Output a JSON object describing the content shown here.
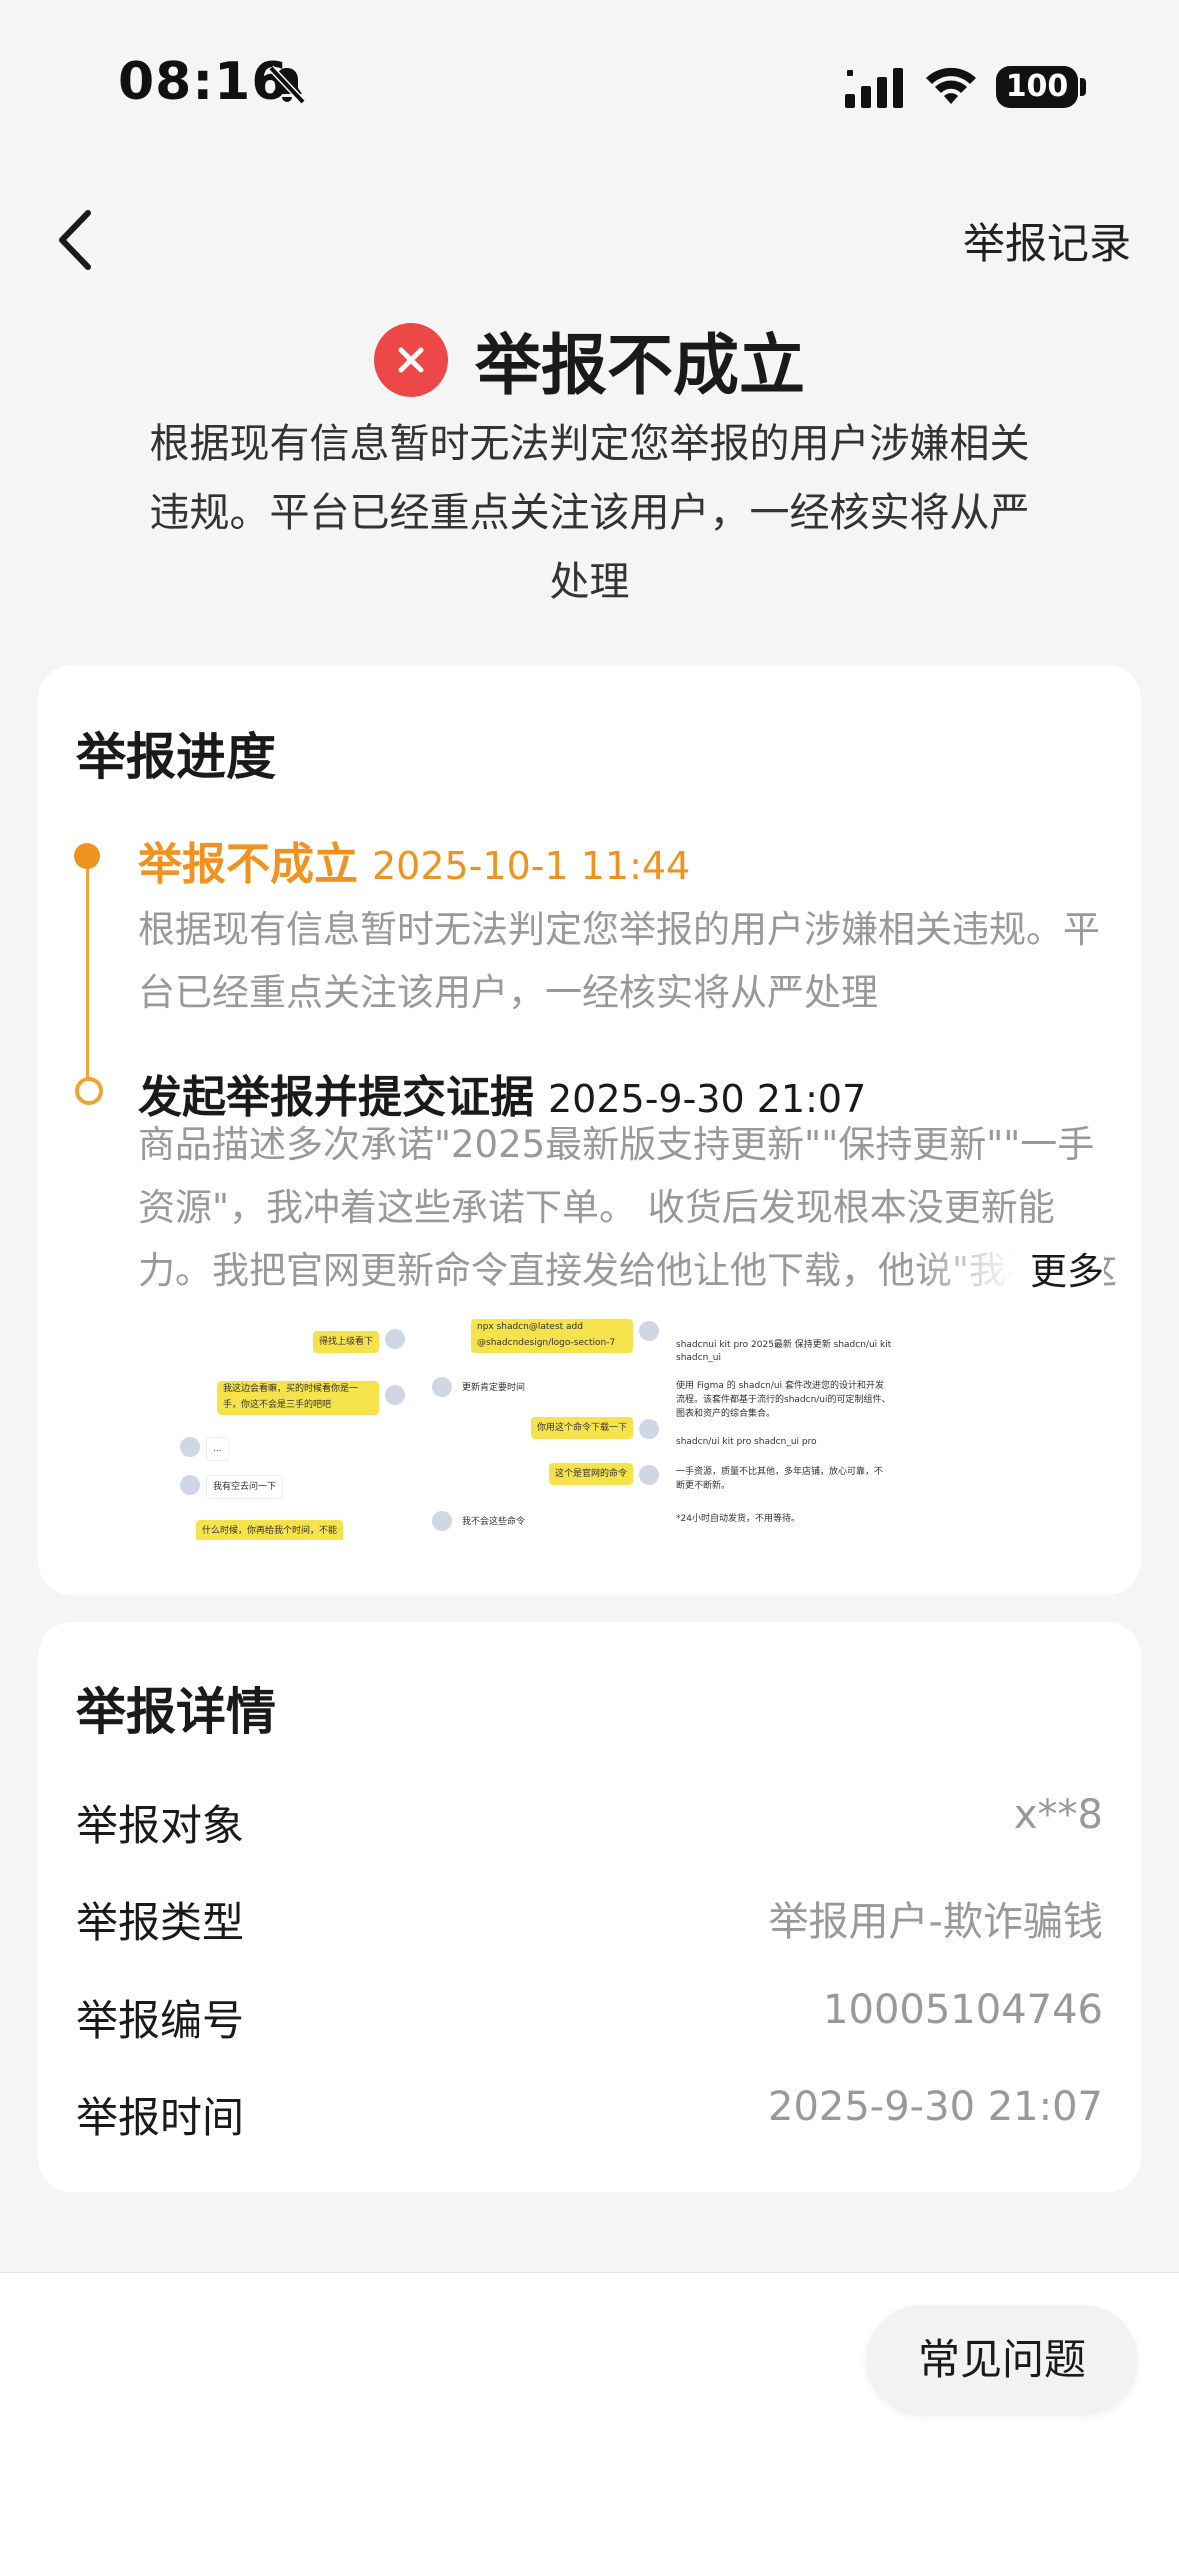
{
  "status_bar": {
    "time": "08:16",
    "battery": "100"
  },
  "nav": {
    "history_label": "举报记录"
  },
  "result": {
    "title": "举报不成立",
    "description": "根据现有信息暂时无法判定您举报的用户涉嫌相关违规。平台已经重点关注该用户，一经核实将从严处理"
  },
  "progress": {
    "section_title": "举报进度",
    "steps": [
      {
        "title": "举报不成立",
        "time": "2025-10-1 11:44",
        "description": "根据现有信息暂时无法判定您举报的用户涉嫌相关违规。平台已经重点关注该用户，一经核实将从严处理"
      },
      {
        "title": "发起举报并提交证据",
        "time": "2025-9-30 21:07",
        "description": "商品描述多次承诺\"2025最新版支持更新\"\"保持更新\"\"一手资源\"，我冲着这些承诺下单。 收货后发现根本没更新能力。我把官网更新命令直接发给他让他下载，他说\"我不会这",
        "more_label": "更多"
      }
    ],
    "evidence": {
      "chat1": [
        "得找上级看下",
        "我这边会看嘛，买的时候看你是一手，你这不会是三手的吧吧",
        "...",
        "我有空去问一下",
        "什么时候，你再给我个时间，不能"
      ],
      "chat2": [
        "npx shadcn@latest add @shadcndesign/logo-section-7",
        "更新肯定要时间",
        "你用这个命令下载一下",
        "这个是官网的命令",
        "我不会这些命令"
      ],
      "doc": [
        "shadcnui kit pro 2025最新 保持更新 shadcn/ui kit",
        "shadcn_ui",
        "使用 Figma 的 shadcn/ui 套件改进您的设计和开发流程。该套件都基于流行的shadcn/ui的可定制组件、图表和资产的综合集合。",
        "shadcn/ui kit pro  shadcn_ui pro",
        "一手资源，质量不比其他，多年店铺，放心可靠，不断更不断新。",
        "*24小时自动发货，不用等待。"
      ]
    }
  },
  "details": {
    "section_title": "举报详情",
    "rows": [
      {
        "label": "举报对象",
        "value": "x**8"
      },
      {
        "label": "举报类型",
        "value": "举报用户-欺诈骗钱"
      },
      {
        "label": "举报编号",
        "value": "10005104746"
      },
      {
        "label": "举报时间",
        "value": "2025-9-30 21:07"
      }
    ]
  },
  "bottom": {
    "faq_label": "常见问题"
  },
  "colors": {
    "accent": "#f0921e",
    "fail_red": "#ee4747",
    "muted_text": "#999999"
  }
}
